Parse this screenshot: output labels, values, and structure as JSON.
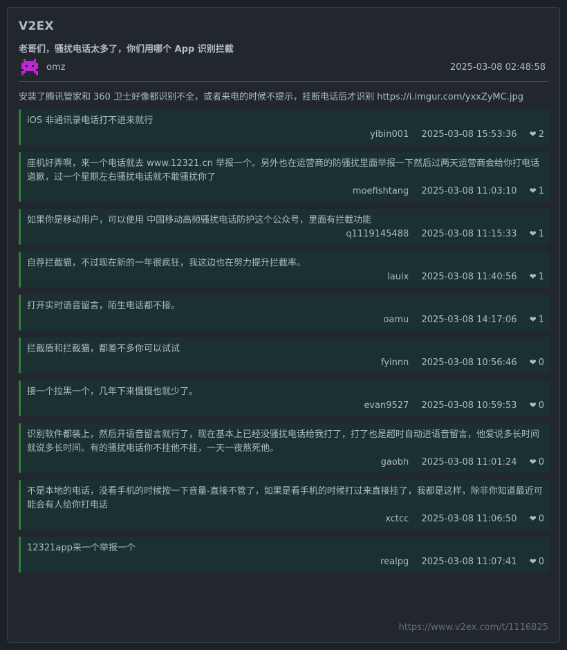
{
  "site": {
    "name": "V2EX"
  },
  "topic": {
    "title": "老哥们，骚扰电话太多了，你们用哪个 App 识别拦截",
    "author": "omz",
    "time": "2025-03-08 02:48:58",
    "body": "安装了腾讯管家和 360 卫士好像都识别不全，或者来电的时候不提示，挂断电话后才识别 https://i.imgur.com/yxxZyMC.jpg"
  },
  "replies": [
    {
      "text": "iOS 非通讯录电话打不进来就行",
      "user": "yibin001",
      "time": "2025-03-08 15:53:36",
      "likes": "2"
    },
    {
      "text": "座机好弄啊，来一个电话就去 www.12321.cn 举报一个。另外也在运营商的防骚扰里面举报一下然后过两天运营商会给你打电话道歉，过一个星期左右骚扰电话就不敢骚扰你了",
      "user": "moefishtang",
      "time": "2025-03-08 11:03:10",
      "likes": "1"
    },
    {
      "text": "如果你是移动用户，可以使用 中国移动高频骚扰电话防护这个公众号，里面有拦截功能",
      "user": "q1119145488",
      "time": "2025-03-08 11:15:33",
      "likes": "1"
    },
    {
      "text": "自荐拦截猫，不过现在新的一年很疯狂，我这边也在努力提升拦截率。",
      "user": "lauix",
      "time": "2025-03-08 11:40:56",
      "likes": "1"
    },
    {
      "text": "打开实时语音留言，陌生电话都不接。",
      "user": "oamu",
      "time": "2025-03-08 14:17:06",
      "likes": "1"
    },
    {
      "text": "拦截盾和拦截猫，都差不多你可以试试",
      "user": "fyinnn",
      "time": "2025-03-08 10:56:46",
      "likes": "0"
    },
    {
      "text": "接一个拉黑一个，几年下来慢慢也就少了。",
      "user": "evan9527",
      "time": "2025-03-08 10:59:53",
      "likes": "0"
    },
    {
      "text": "识别软件都装上，然后开语音留言就行了，现在基本上已经没骚扰电话给我打了，打了也是超时自动进语音留言，他爱说多长时间就说多长时间。有的骚扰电话你不挂他不挂，一天一夜熬死他。",
      "user": "gaobh",
      "time": "2025-03-08 11:01:24",
      "likes": "0"
    },
    {
      "text": "不是本地的电话，没看手机的时候按一下音量-直接不管了，如果是看手机的时候打过来直接挂了，我都是这样，除非你知道最近可能会有人给你打电话",
      "user": "xctcc",
      "time": "2025-03-08 11:06:50",
      "likes": "0"
    },
    {
      "text": "12321app来一个举报一个",
      "user": "realpg",
      "time": "2025-03-08 11:07:41",
      "likes": "0"
    }
  ],
  "footer": {
    "url": "https://www.v2ex.com/t/1116825"
  },
  "icons": {
    "like": "heart-icon",
    "avatar": "pixel-avatar"
  },
  "colors": {
    "accent": "#347d39",
    "reply_bg": "#1b3030",
    "card_bg": "#22272e",
    "avatar": "#c026d3"
  }
}
